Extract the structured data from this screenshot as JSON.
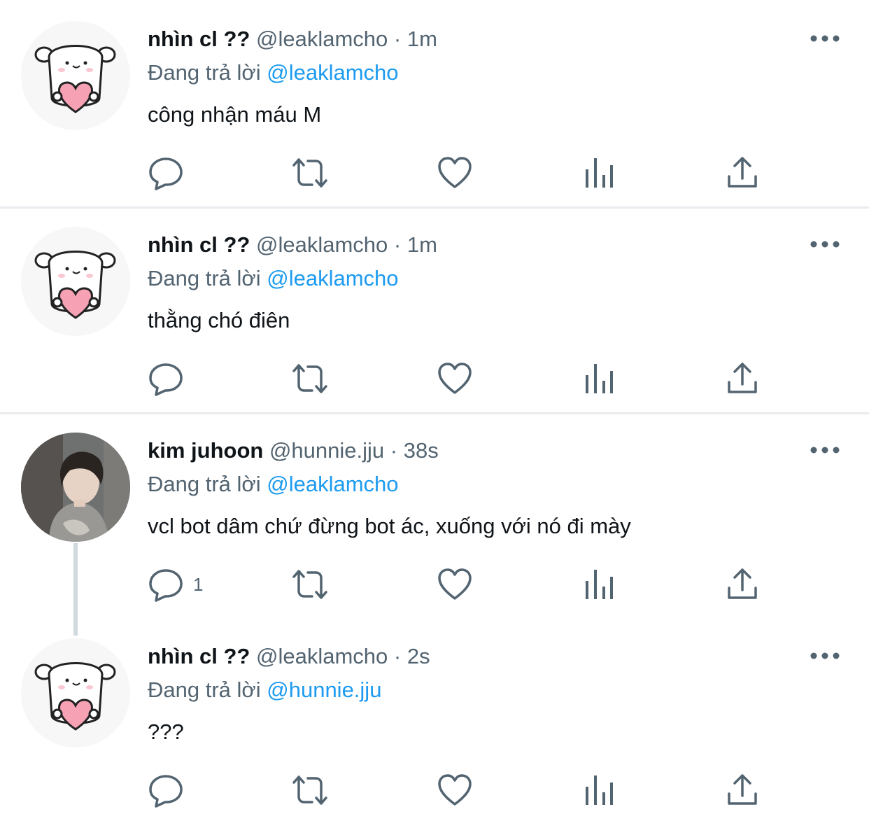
{
  "tweets": [
    {
      "display_name": "nhìn cl ??",
      "handle": "@leaklamcho",
      "separator": "·",
      "time": "1m",
      "reply_prefix": "Đang trả lời",
      "reply_to": "@leaklamcho",
      "text": "công nhận máu M",
      "reply_count": "",
      "avatar": "dog-holding-heart-avatar"
    },
    {
      "display_name": "nhìn cl ??",
      "handle": "@leaklamcho",
      "separator": "·",
      "time": "1m",
      "reply_prefix": "Đang trả lời",
      "reply_to": "@leaklamcho",
      "text": "thằng chó điên",
      "reply_count": "",
      "avatar": "dog-holding-heart-avatar"
    },
    {
      "display_name": "kim juhoon",
      "handle": "@hunnie.jju",
      "separator": "·",
      "time": "38s",
      "reply_prefix": "Đang trả lời",
      "reply_to": "@leaklamcho",
      "text": "vcl bot dâm chứ đừng bot ác, xuống với nó đi mày",
      "reply_count": "1",
      "avatar": "photo-avatar"
    },
    {
      "display_name": "nhìn cl ??",
      "handle": "@leaklamcho",
      "separator": "·",
      "time": "2s",
      "reply_prefix": "Đang trả lời",
      "reply_to": "@hunnie.jju",
      "text": "???",
      "reply_count": "",
      "avatar": "dog-holding-heart-avatar"
    }
  ],
  "icons": {
    "reply": "reply-bubble-icon",
    "retweet": "retweet-icon",
    "like": "heart-icon",
    "views": "analytics-bars-icon",
    "share": "share-upload-icon",
    "more": "more-dots-icon"
  },
  "colors": {
    "text": "#0f1419",
    "secondary": "#536471",
    "link": "#1d9bf0",
    "divider": "#e9ebee",
    "heart_pink": "#f6a1b4"
  }
}
